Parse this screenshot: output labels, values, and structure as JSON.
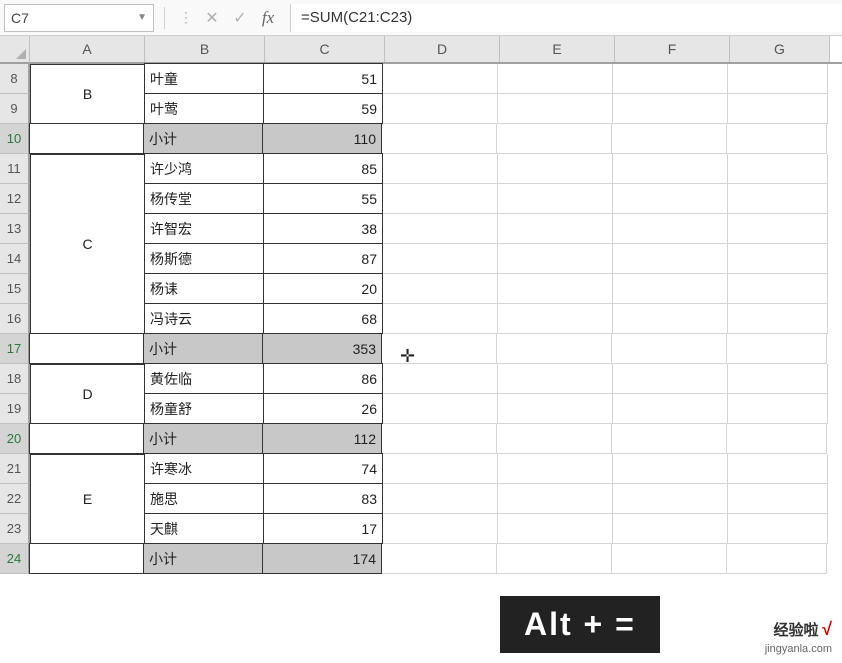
{
  "nameBox": "C7",
  "formula": "=SUM(C21:C23)",
  "columns": [
    "A",
    "B",
    "C",
    "D",
    "E",
    "F",
    "G"
  ],
  "rows": [
    {
      "n": 8,
      "sel": false,
      "a": "B",
      "b": "叶童",
      "c": "51",
      "sub": false,
      "mergeStart": true,
      "mergeSpan": 2
    },
    {
      "n": 9,
      "sel": false,
      "a": "",
      "b": "叶莺",
      "c": "59",
      "sub": false
    },
    {
      "n": 10,
      "sel": true,
      "a": "",
      "b": "小计",
      "c": "110",
      "sub": true
    },
    {
      "n": 11,
      "sel": false,
      "a": "C",
      "b": "许少鸿",
      "c": "85",
      "sub": false,
      "mergeStart": true,
      "mergeSpan": 6
    },
    {
      "n": 12,
      "sel": false,
      "a": "",
      "b": "杨传堂",
      "c": "55",
      "sub": false
    },
    {
      "n": 13,
      "sel": false,
      "a": "",
      "b": "许智宏",
      "c": "38",
      "sub": false
    },
    {
      "n": 14,
      "sel": false,
      "a": "",
      "b": "杨斯德",
      "c": "87",
      "sub": false
    },
    {
      "n": 15,
      "sel": false,
      "a": "",
      "b": "杨诔",
      "c": "20",
      "sub": false
    },
    {
      "n": 16,
      "sel": false,
      "a": "",
      "b": "冯诗云",
      "c": "68",
      "sub": false
    },
    {
      "n": 17,
      "sel": true,
      "a": "",
      "b": "小计",
      "c": "353",
      "sub": true
    },
    {
      "n": 18,
      "sel": false,
      "a": "D",
      "b": "黄佐临",
      "c": "86",
      "sub": false,
      "mergeStart": true,
      "mergeSpan": 2
    },
    {
      "n": 19,
      "sel": false,
      "a": "",
      "b": "杨童舒",
      "c": "26",
      "sub": false
    },
    {
      "n": 20,
      "sel": true,
      "a": "",
      "b": "小计",
      "c": "112",
      "sub": true
    },
    {
      "n": 21,
      "sel": false,
      "a": "E",
      "b": "许寒冰",
      "c": "74",
      "sub": false,
      "mergeStart": true,
      "mergeSpan": 3
    },
    {
      "n": 22,
      "sel": false,
      "a": "",
      "b": "施思",
      "c": "83",
      "sub": false
    },
    {
      "n": 23,
      "sel": false,
      "a": "",
      "b": "天麒",
      "c": "17",
      "sub": false
    },
    {
      "n": 24,
      "sel": true,
      "a": "",
      "b": "小计",
      "c": "174",
      "sub": true
    }
  ],
  "shortcut": "Alt + =",
  "watermark": {
    "brand": "经验啦",
    "check": "√",
    "url": "jingyanla.com"
  },
  "cursorPlus": "✛"
}
